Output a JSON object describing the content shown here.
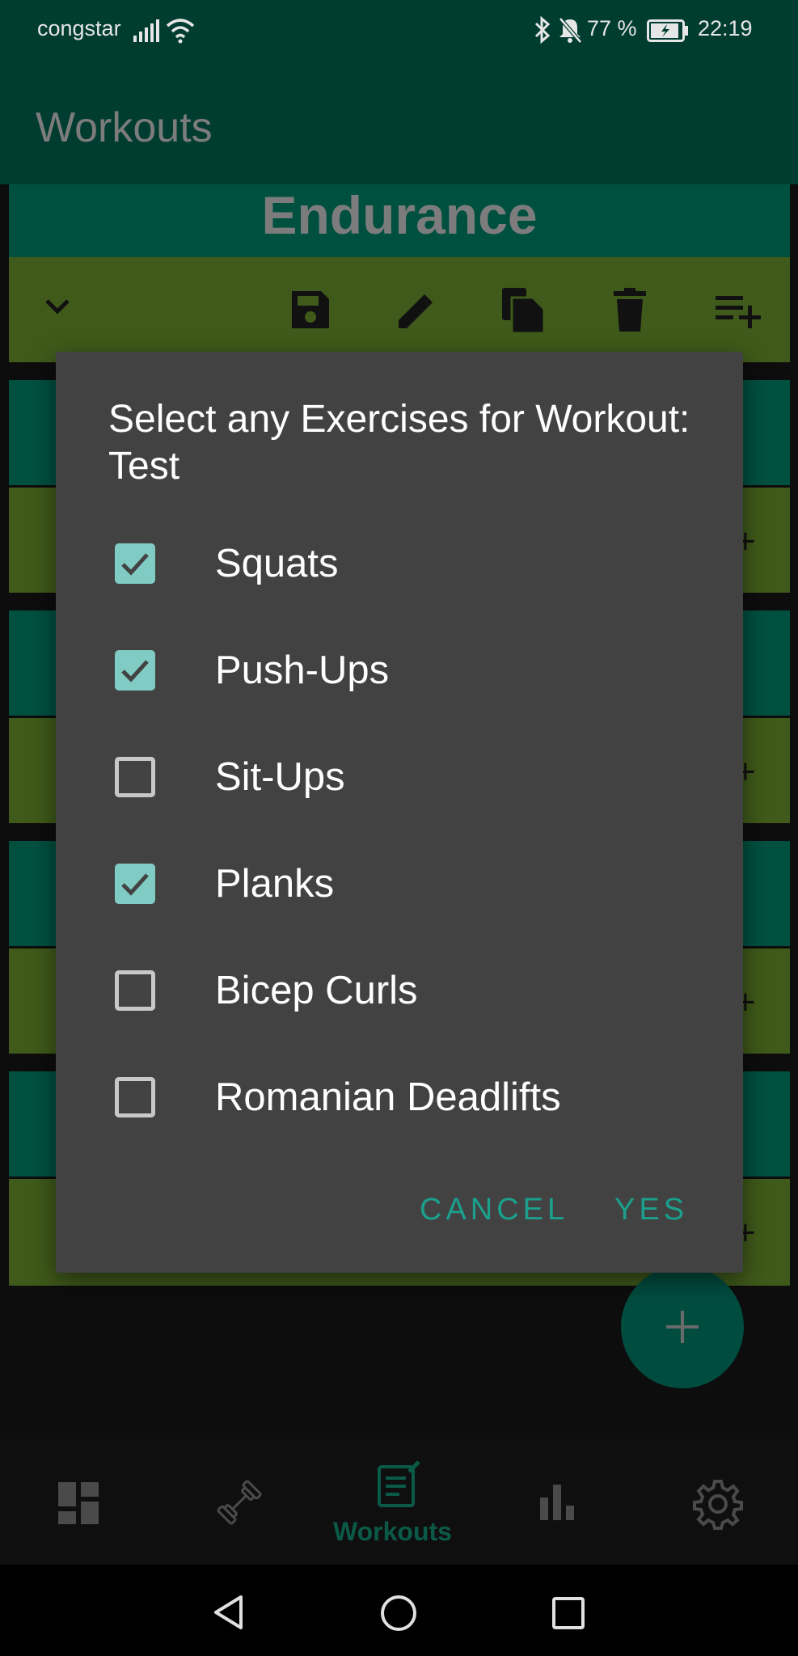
{
  "status_bar": {
    "carrier": "congstar",
    "battery": "77 %",
    "time": "22:19"
  },
  "app_bar": {
    "title": "Workouts"
  },
  "workout_card": {
    "title": "Endurance"
  },
  "dialog": {
    "title": "Select any Exercises for Workout: Test",
    "options": [
      {
        "label": "Squats",
        "checked": true
      },
      {
        "label": "Push-Ups",
        "checked": true
      },
      {
        "label": "Sit-Ups",
        "checked": false
      },
      {
        "label": "Planks",
        "checked": true
      },
      {
        "label": "Bicep Curls",
        "checked": false
      },
      {
        "label": "Romanian Deadlifts",
        "checked": false
      }
    ],
    "cancel_label": "CANCEL",
    "yes_label": "YES"
  },
  "bottom_nav": {
    "active_label": "Workouts",
    "items": [
      "dashboard-icon",
      "dumbbell-icon",
      "workouts-icon",
      "stats-icon",
      "settings-icon"
    ]
  },
  "colors": {
    "accent": "#1aa08c",
    "checkbox": "#80cbc4",
    "dialog_bg": "#424242",
    "appbar_dim": "#003d30",
    "tools_dim": "#3f5a1a"
  }
}
